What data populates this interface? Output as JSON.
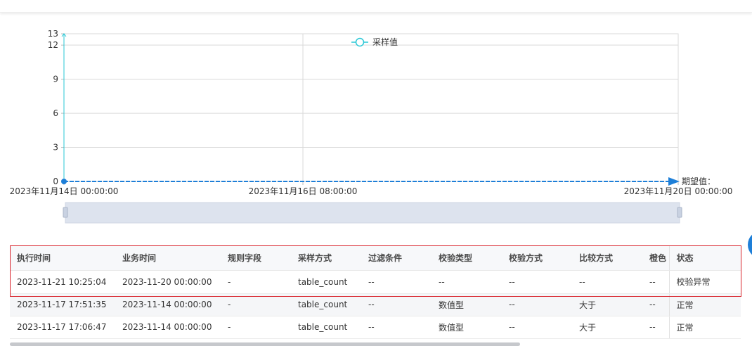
{
  "chart_data": {
    "type": "line",
    "legend": "采样值",
    "yticks": [
      0,
      3,
      6,
      9,
      12,
      13
    ],
    "ylim": [
      0,
      13
    ],
    "xtick_labels": [
      "2023年11月14日 00:00:00",
      "2023年11月16日 08:00:00",
      "2023年11月20日 00:00:00"
    ],
    "expected_label": "期望值：",
    "series": [
      {
        "values": [
          0,
          0
        ]
      }
    ],
    "grid": true,
    "legend_position": "top-center"
  },
  "colors": {
    "accent": "#1e7fd8",
    "series": "#28c7d6",
    "highlight": "#d9222a"
  },
  "table": {
    "headers": [
      "执行时间",
      "业务时间",
      "规则字段",
      "采样方式",
      "过滤条件",
      "校验类型",
      "校验方式",
      "比较方式",
      "橙色",
      "状态"
    ],
    "rows": [
      [
        "2023-11-21 10:25:04",
        "2023-11-20 00:00:00",
        "-",
        "table_count",
        "--",
        "--",
        "--",
        "--",
        "--",
        "校验异常"
      ],
      [
        "2023-11-17 17:51:35",
        "2023-11-14 00:00:00",
        "-",
        "table_count",
        "--",
        "数值型",
        "--",
        "大于",
        "--",
        "正常"
      ],
      [
        "2023-11-17 17:06:47",
        "2023-11-14 00:00:00",
        "-",
        "table_count",
        "--",
        "数值型",
        "--",
        "大于",
        "--",
        "正常"
      ]
    ]
  }
}
